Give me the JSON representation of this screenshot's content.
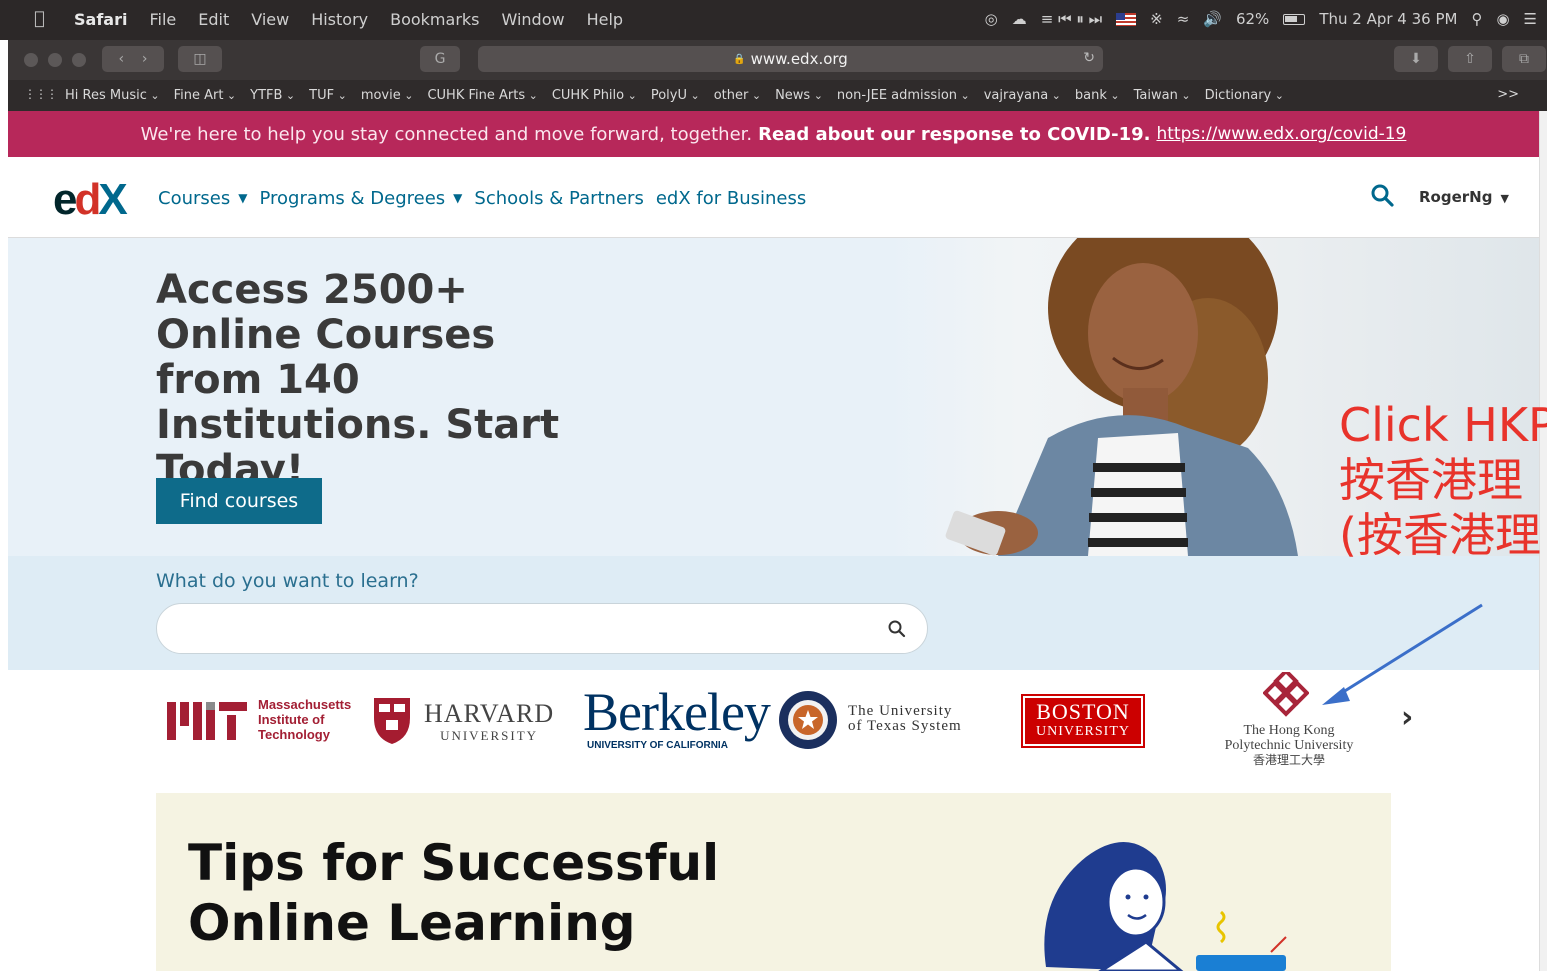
{
  "menubar": {
    "app": "Safari",
    "items": [
      "File",
      "Edit",
      "View",
      "History",
      "Bookmarks",
      "Window",
      "Help"
    ],
    "battery": "62%",
    "clock": "Thu 2 Apr  4 36 PM"
  },
  "toolbar": {
    "url": "www.edx.org"
  },
  "favorites": {
    "items": [
      "Hi Res Music",
      "Fine Art",
      "YTFB",
      "TUF",
      "movie",
      "CUHK Fine Arts",
      "CUHK Philo",
      "PolyU",
      "other",
      "News",
      "non-JEE admission",
      "vajrayana",
      "bank",
      "Taiwan",
      "Dictionary"
    ],
    "more": ">>"
  },
  "covid_banner": {
    "text": "We're here to help you stay connected and move forward, together.",
    "bold": "Read about our response to COVID-19.",
    "link": "https://www.edx.org/covid-19"
  },
  "header": {
    "nav": {
      "courses": "Courses",
      "programs": "Programs & Degrees",
      "schools": "Schools & Partners",
      "business": "edX for Business"
    },
    "user": "RogerNg"
  },
  "hero": {
    "title": "Access 2500+ Online Courses from 140 Institutions. Start Today!",
    "button": "Find courses"
  },
  "search": {
    "label": "What do you want to learn?",
    "placeholder": ""
  },
  "partners": {
    "mit": [
      "Massachusetts",
      "Institute of",
      "Technology"
    ],
    "harvard": [
      "HARVARD",
      "UNIVERSITY"
    ],
    "berkeley": [
      "Berkeley",
      "UNIVERSITY OF CALIFORNIA"
    ],
    "texas": [
      "The University",
      "of Texas System"
    ],
    "boston": [
      "BOSTON",
      "UNIVERSITY"
    ],
    "hkpu": [
      "The Hong Kong",
      "Polytechnic University",
      "香港理工大學"
    ]
  },
  "tips": {
    "title": "Tips for Successful Online Learning"
  },
  "annotation": {
    "line1": "Click HKP",
    "line2": "按香港理",
    "line3": "(按香港理"
  },
  "colors": {
    "covid_banner": "#b7285a",
    "edx_blue": "#00688d",
    "button": "#0e6b8a",
    "annotation": "#e8332b"
  }
}
